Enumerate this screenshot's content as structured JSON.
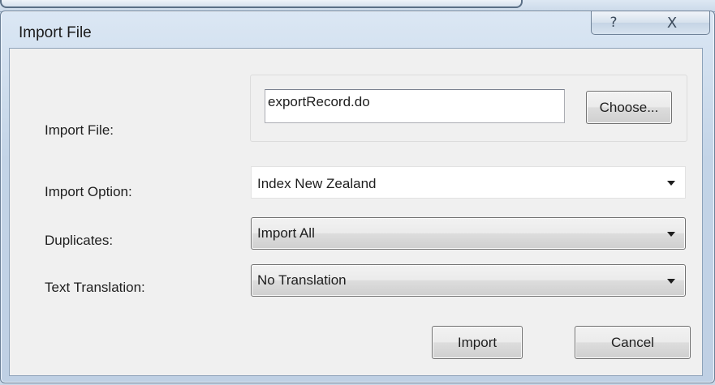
{
  "window": {
    "title": "Import File",
    "help_glyph": "?",
    "close_glyph": "X"
  },
  "form": {
    "import_file": {
      "label": "Import File:",
      "value": "exportRecord.do",
      "choose_label": "Choose..."
    },
    "import_option": {
      "label": "Import Option:",
      "value": "Index New Zealand"
    },
    "duplicates": {
      "label": "Duplicates:",
      "value": "Import All"
    },
    "text_translation": {
      "label": "Text Translation:",
      "value": "No Translation"
    }
  },
  "actions": {
    "import_label": "Import",
    "cancel_label": "Cancel"
  },
  "icons": {
    "help": "help-icon",
    "close": "close-icon",
    "dropdown": "chevron-down-icon"
  }
}
